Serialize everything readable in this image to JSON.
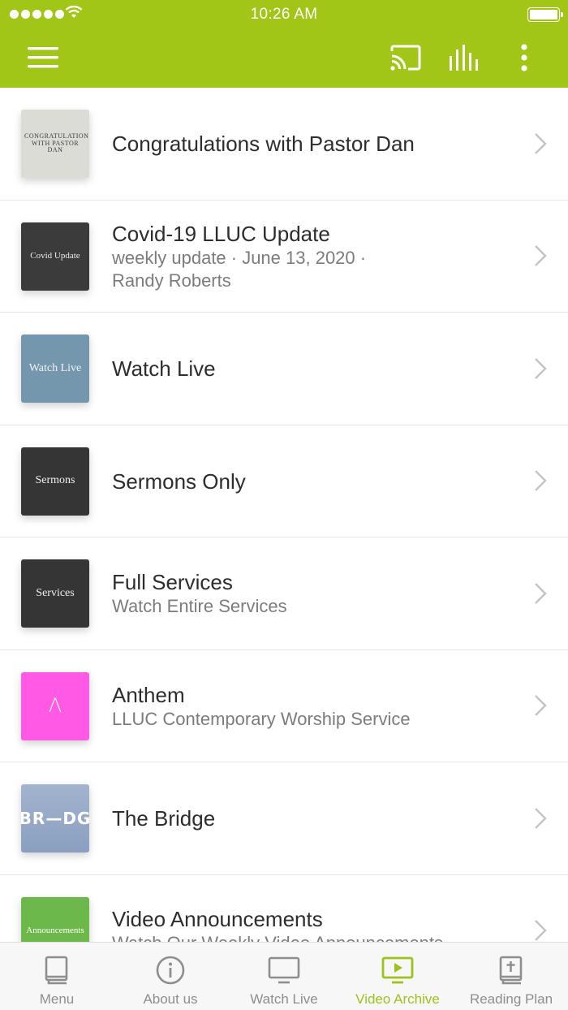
{
  "status_bar": {
    "time": "10:26 AM"
  },
  "colors": {
    "accent": "#a2c617",
    "active_tab": "#9dc21a",
    "text_primary": "#2d2d2d",
    "text_secondary": "#7c7c7c"
  },
  "header": {
    "icons": [
      "hamburger-menu-icon",
      "cast-icon",
      "audio-bars-icon",
      "more-vertical-icon"
    ]
  },
  "items": [
    {
      "title": "Congratulations with Pastor Dan",
      "subtitle": "",
      "subtitle2": "",
      "thumb_text": "CONGRATULATIONS WITH PASTOR DAN",
      "thumb_bg": "#d9dcd6",
      "thumb_fg": "#3a3a3a"
    },
    {
      "title": "Covid-19 LLUC Update",
      "subtitle": "weekly update · June 13, 2020 ·",
      "subtitle2": "Randy Roberts",
      "thumb_text": "Covid Update",
      "thumb_bg": "#3b3b3b",
      "thumb_fg": "#ececec"
    },
    {
      "title": "Watch Live",
      "subtitle": "",
      "subtitle2": "",
      "thumb_text": "Watch Live",
      "thumb_bg": "#7597ad",
      "thumb_fg": "#f2f2f2"
    },
    {
      "title": "Sermons Only",
      "subtitle": "",
      "subtitle2": "",
      "thumb_text": "Sermons",
      "thumb_bg": "#353535",
      "thumb_fg": "#f0f0f0"
    },
    {
      "title": "Full Services",
      "subtitle": "Watch Entire Services",
      "subtitle2": "",
      "thumb_text": "Services",
      "thumb_bg": "#353535",
      "thumb_fg": "#f0f0f0"
    },
    {
      "title": "Anthem",
      "subtitle": "LLUC Contemporary Worship Service",
      "subtitle2": "",
      "thumb_text": "Λ",
      "thumb_bg": "#ff59e6",
      "thumb_fg": "#ffffff"
    },
    {
      "title": "The Bridge",
      "subtitle": "",
      "subtitle2": "",
      "thumb_text": "BR—DG",
      "thumb_bg": "#93a6c6",
      "thumb_fg": "#ffffff"
    },
    {
      "title": "Video Announcements",
      "subtitle": "Watch Our Weekly Video Announcements",
      "subtitle2": "",
      "thumb_text": "Announcements",
      "thumb_bg": "#6cb84a",
      "thumb_fg": "#ffffff"
    }
  ],
  "tabs": [
    {
      "label": "Menu",
      "icon": "book-icon",
      "active": false
    },
    {
      "label": "About us",
      "icon": "info-icon",
      "active": false
    },
    {
      "label": "Watch Live",
      "icon": "monitor-icon",
      "active": false
    },
    {
      "label": "Video Archive",
      "icon": "video-player-icon",
      "active": true
    },
    {
      "label": "Reading Plan",
      "icon": "bible-icon",
      "active": false
    }
  ]
}
